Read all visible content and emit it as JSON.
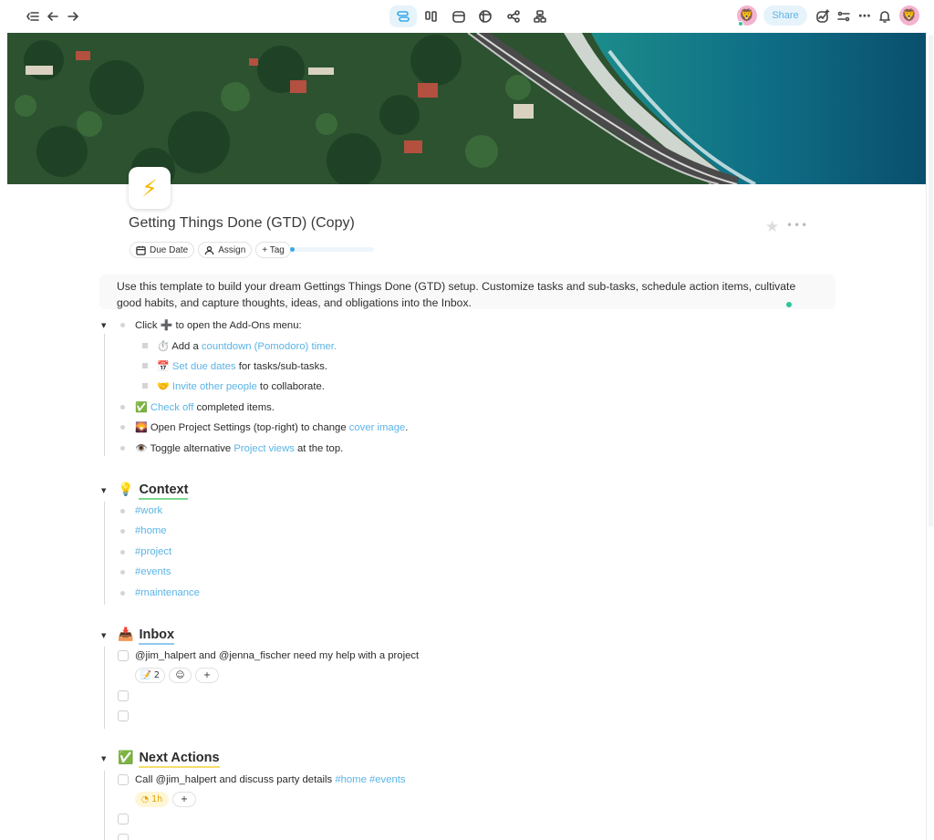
{
  "toolbar": {
    "share_label": "Share"
  },
  "project": {
    "icon": "⚡",
    "title": "Getting Things Done (GTD) (Copy)",
    "chips": {
      "due_date": "Due Date",
      "assign": "Assign",
      "tag": "+ Tag"
    },
    "progress": 0.03,
    "description": "Use this template to build your dream Gettings Things Done (GTD) setup. Customize tasks and sub-tasks, schedule action items, cultivate good habits, and capture thoughts, ideas, and obligations into the Inbox."
  },
  "intro": {
    "item1": {
      "pre": "Click ",
      "emoji": "➕",
      "post": " to open the Add-Ons menu:"
    },
    "sub1": {
      "emoji": "⏱️",
      "pre": " Add a ",
      "link": "countdown (Pomodoro) timer."
    },
    "sub2": {
      "emoji": "📅",
      "link": "Set due dates",
      "post": " for tasks/sub-tasks."
    },
    "sub3": {
      "emoji": "🤝",
      "link": "Invite other people",
      "post": " to collaborate."
    },
    "item2": {
      "emoji": "✅",
      "link": "Check off",
      "post": " completed items."
    },
    "item3": {
      "emoji": "🌄",
      "pre": " Open Project Settings (top-right) to change ",
      "link": "cover image",
      "post": "."
    },
    "item4": {
      "emoji": "👁️",
      "pre": " Toggle alternative ",
      "link": "Project views",
      "post": " at the top."
    }
  },
  "context": {
    "emoji": "💡",
    "title": "Context",
    "tags": [
      "#work",
      "#home",
      "#project",
      "#events",
      "#maintenance"
    ]
  },
  "inbox": {
    "emoji": "📥",
    "title": "Inbox",
    "task1": "@jim_halpert and @jenna_fischer need my help with a project",
    "notes_count": "2",
    "add": "+"
  },
  "next_actions": {
    "emoji": "✅",
    "title": "Next Actions",
    "task1_text": "Call @jim_halpert and discuss party details ",
    "task1_tags": "#home #events",
    "timer": "1h",
    "add": "+"
  },
  "colors": {
    "accent": "#38a9e6",
    "link": "#5ab4e6",
    "context_underline": "#7bd88f",
    "inbox_underline": "#8ec9f0",
    "next_underline": "#f5de6b",
    "online": "#2fc59b"
  }
}
